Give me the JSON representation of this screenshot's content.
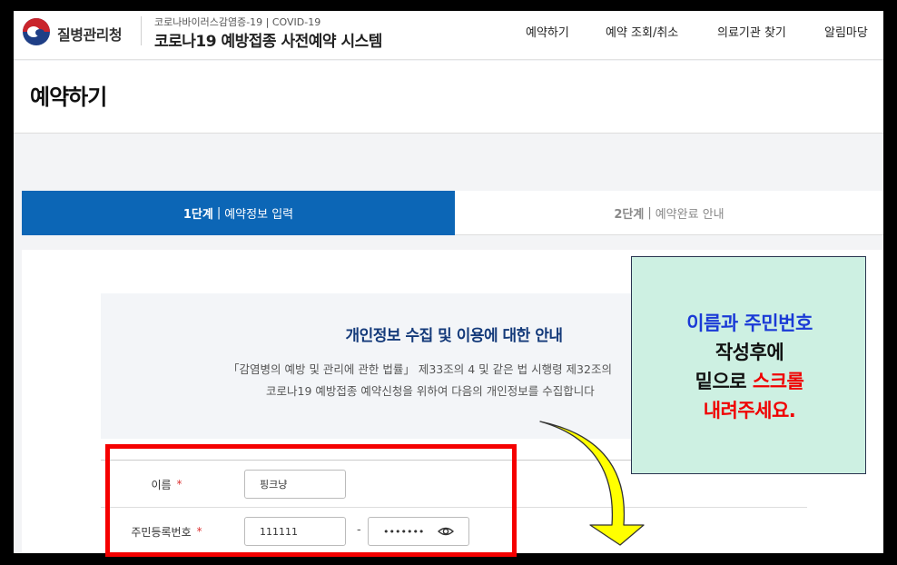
{
  "header": {
    "logo_text": "질병관리청",
    "sub_title": "코로나바이러스감염증-19 | COVID-19",
    "main_title": "코로나19 예방접종 사전예약 시스템",
    "nav": [
      "예약하기",
      "예약 조회/취소",
      "의료기관 찾기",
      "알림마당"
    ]
  },
  "page_title": "예약하기",
  "steps": [
    {
      "num": "1단계",
      "sep": "|",
      "label": "예약정보 입력",
      "active": true
    },
    {
      "num": "2단계",
      "sep": "|",
      "label": "예약완료 안내",
      "active": false
    }
  ],
  "notice": {
    "title": "개인정보 수집 및 이용에 대한 안내",
    "line1": "「감염병의 예방 및 관리에 관한 법률」 제33조의 4 및 같은 법 시행령 제32조의",
    "line2": "코로나19 예방접종 예약신청을 위하여 다음의 개인정보를 수집합니다"
  },
  "form": {
    "name_label": "이름",
    "name_value": "핑크냥",
    "rrn_label": "주민등록번호",
    "rrn_front": "111111",
    "rrn_dash": "-",
    "rrn_back": "•••••••",
    "required_mark": "*"
  },
  "callout": {
    "line1": "이름과 주민번호",
    "line2": "작성후에",
    "line3_a": "밑으로 ",
    "line3_b": "스크롤",
    "line4": "내려주세요."
  },
  "colors": {
    "primary_blue": "#0c66b6",
    "callout_bg": "#cdf0e2",
    "callout_blue": "#1a3ad6",
    "callout_red": "#f00000",
    "annotation_red": "#f50000",
    "arrow_yellow": "#ffff00"
  },
  "icons": [
    "government-logo-icon",
    "eye-icon",
    "yellow-arrow-icon"
  ]
}
